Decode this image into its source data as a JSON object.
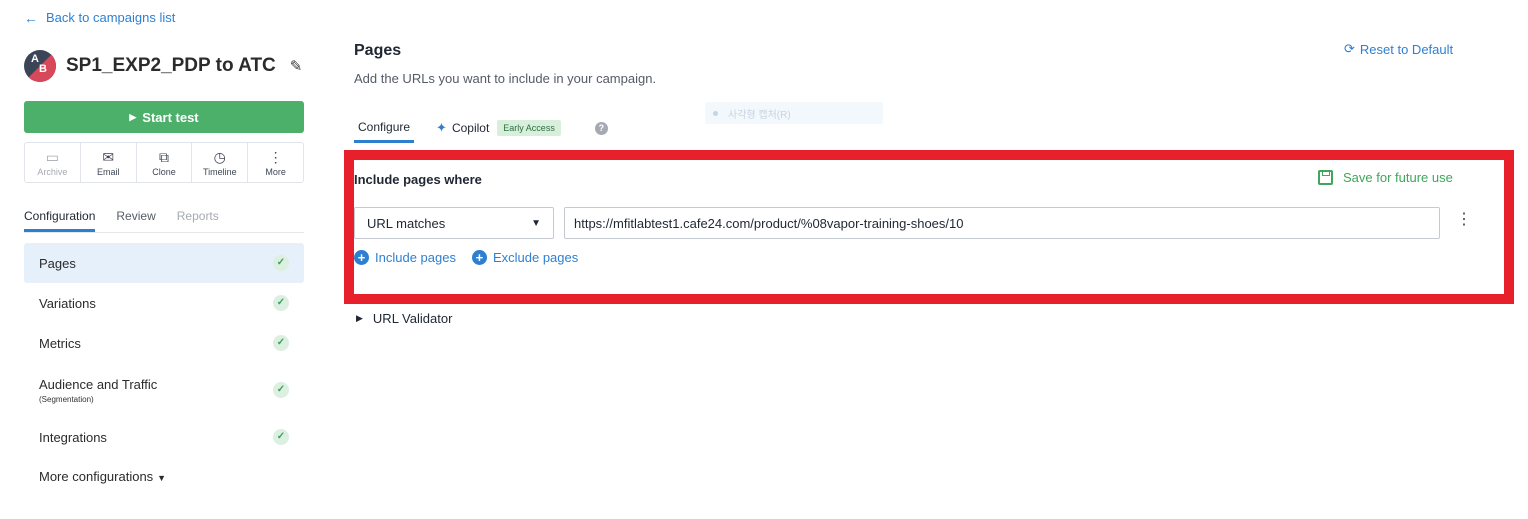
{
  "sidebar": {
    "back_label": "Back to campaigns list",
    "avatar": {
      "a": "A",
      "b": "B"
    },
    "campaign_name": "SP1_EXP2_PDP to ATC",
    "start_label": "Start test",
    "actions": [
      {
        "label": "Archive",
        "icon": "archive-icon"
      },
      {
        "label": "Email",
        "icon": "email-icon"
      },
      {
        "label": "Clone",
        "icon": "clone-icon"
      },
      {
        "label": "Timeline",
        "icon": "timeline-icon"
      },
      {
        "label": "More",
        "icon": "more-icon"
      }
    ],
    "tabs": [
      "Configuration",
      "Review",
      "Reports"
    ],
    "nav": [
      {
        "label": "Pages"
      },
      {
        "label": "Variations"
      },
      {
        "label": "Metrics"
      },
      {
        "label": "Audience and Traffic",
        "sub": "(Segmentation)"
      },
      {
        "label": "Integrations"
      }
    ],
    "more_configurations": "More configurations"
  },
  "main": {
    "title": "Pages",
    "subtitle": "Add the URLs you want to include in your campaign.",
    "reset_label": "Reset to Default",
    "ghost_text": "사각형 캡처(R)",
    "tabs": {
      "configure": "Configure",
      "copilot": "Copilot",
      "badge": "Early Access",
      "help": "?"
    },
    "include_label": "Include pages where",
    "save_future_label": "Save for future use",
    "match_type": "URL matches",
    "url_value": "https://mfitlabtest1.cafe24.com/product/%08vapor-training-shoes/10",
    "include_pages_label": "Include pages",
    "exclude_pages_label": "Exclude pages",
    "validator_label": "URL Validator"
  },
  "colors": {
    "accent": "#2f7fd1",
    "start_button": "#4caf6a",
    "save_green": "#3fa65c",
    "highlight_red": "#e8202b"
  }
}
